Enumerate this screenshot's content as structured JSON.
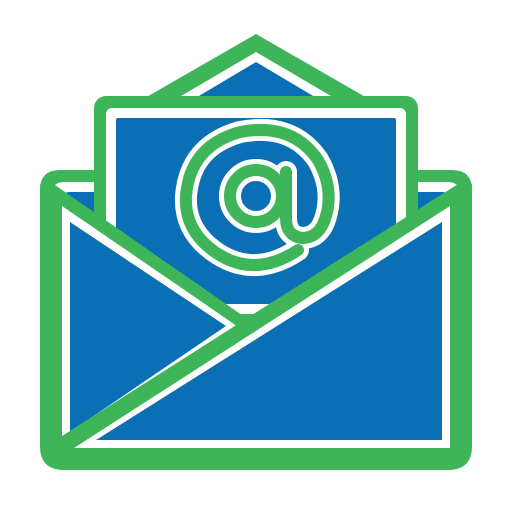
{
  "icon": {
    "name": "open-envelope-email-icon",
    "symbol": "at-sign",
    "colors": {
      "outline": "#3fb55a",
      "fill": "#0b6fb6",
      "fill_light": "#1a82c8",
      "inner_stroke": "#ffffff",
      "background": "#ffffff"
    }
  }
}
